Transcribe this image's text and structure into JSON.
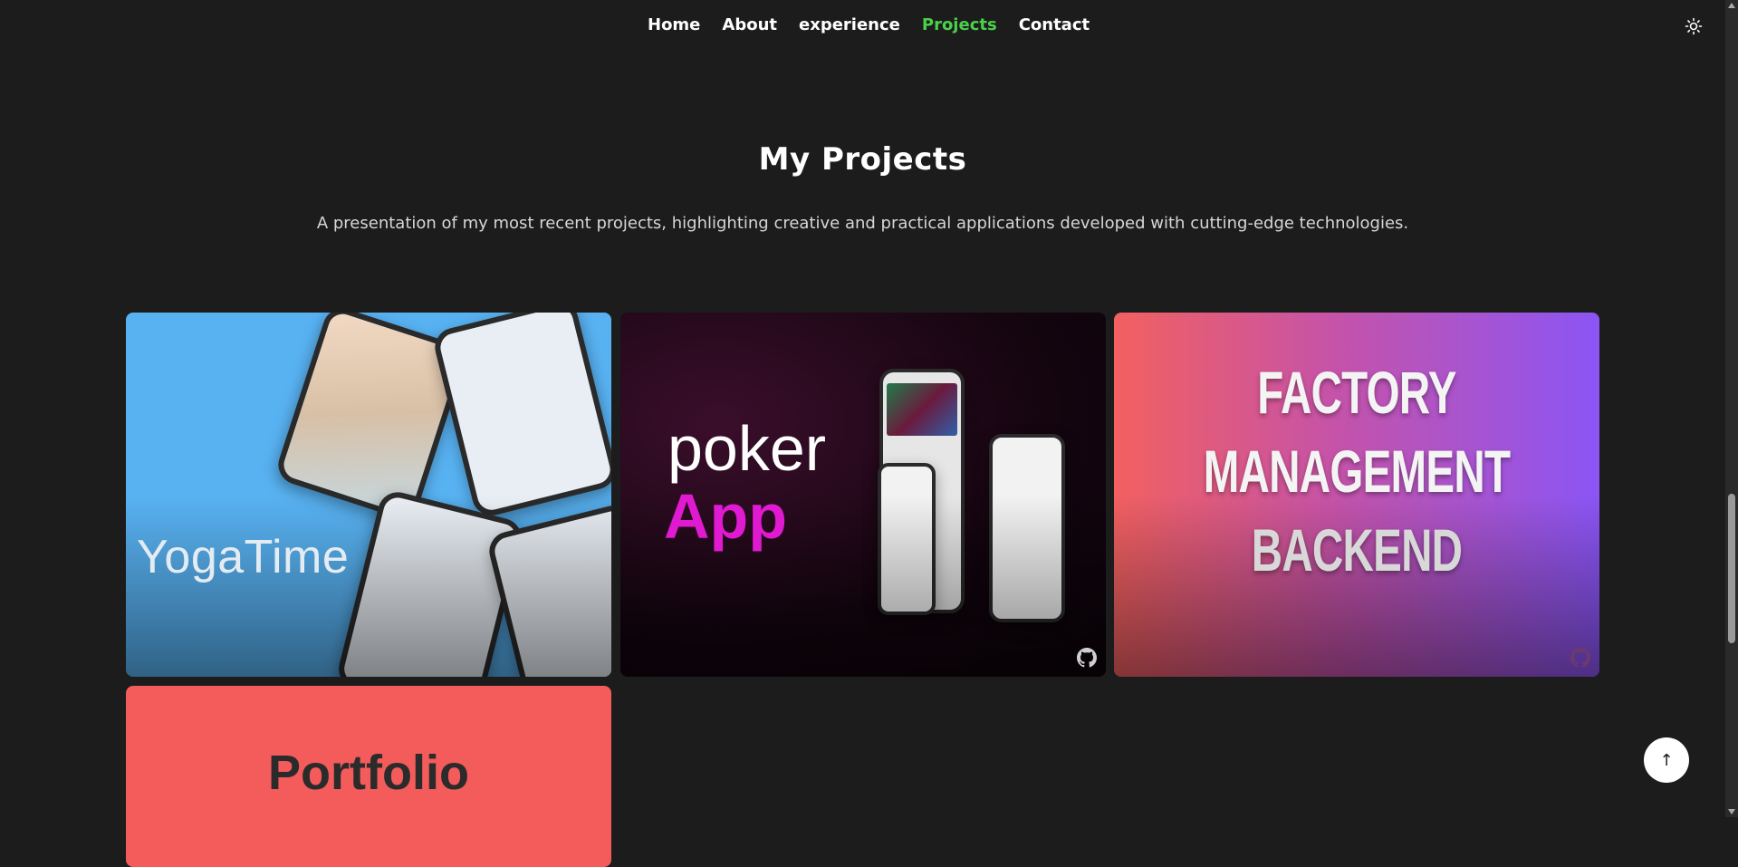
{
  "nav": {
    "items": [
      {
        "label": "Home",
        "active": false
      },
      {
        "label": "About",
        "active": false
      },
      {
        "label": "experience",
        "active": false
      },
      {
        "label": "Projects",
        "active": true
      },
      {
        "label": "Contact",
        "active": false
      }
    ],
    "theme_icon": "sun-icon"
  },
  "colors": {
    "background": "#1c1c1c",
    "active_nav": "#4ad04a",
    "accent_pink": "#e01ad0"
  },
  "section": {
    "title": "My Projects",
    "subtitle": "A presentation of my most recent projects, highlighting creative and practical applications developed with cutting-edge technologies."
  },
  "projects": [
    {
      "name": "YogaTime",
      "label": "YogaTime"
    },
    {
      "name": "poker App",
      "label_line1": "poker",
      "label_line2": "App",
      "icon": "github-icon"
    },
    {
      "name": "Factory Management Backend",
      "label_line1": "FACTORY",
      "label_line2": "MANAGEMENT",
      "label_line3": "BACKEND",
      "icon": "github-icon"
    },
    {
      "name": "Portfolio",
      "label": "Portfolio"
    }
  ],
  "scroll_top": {
    "label": "↑"
  }
}
